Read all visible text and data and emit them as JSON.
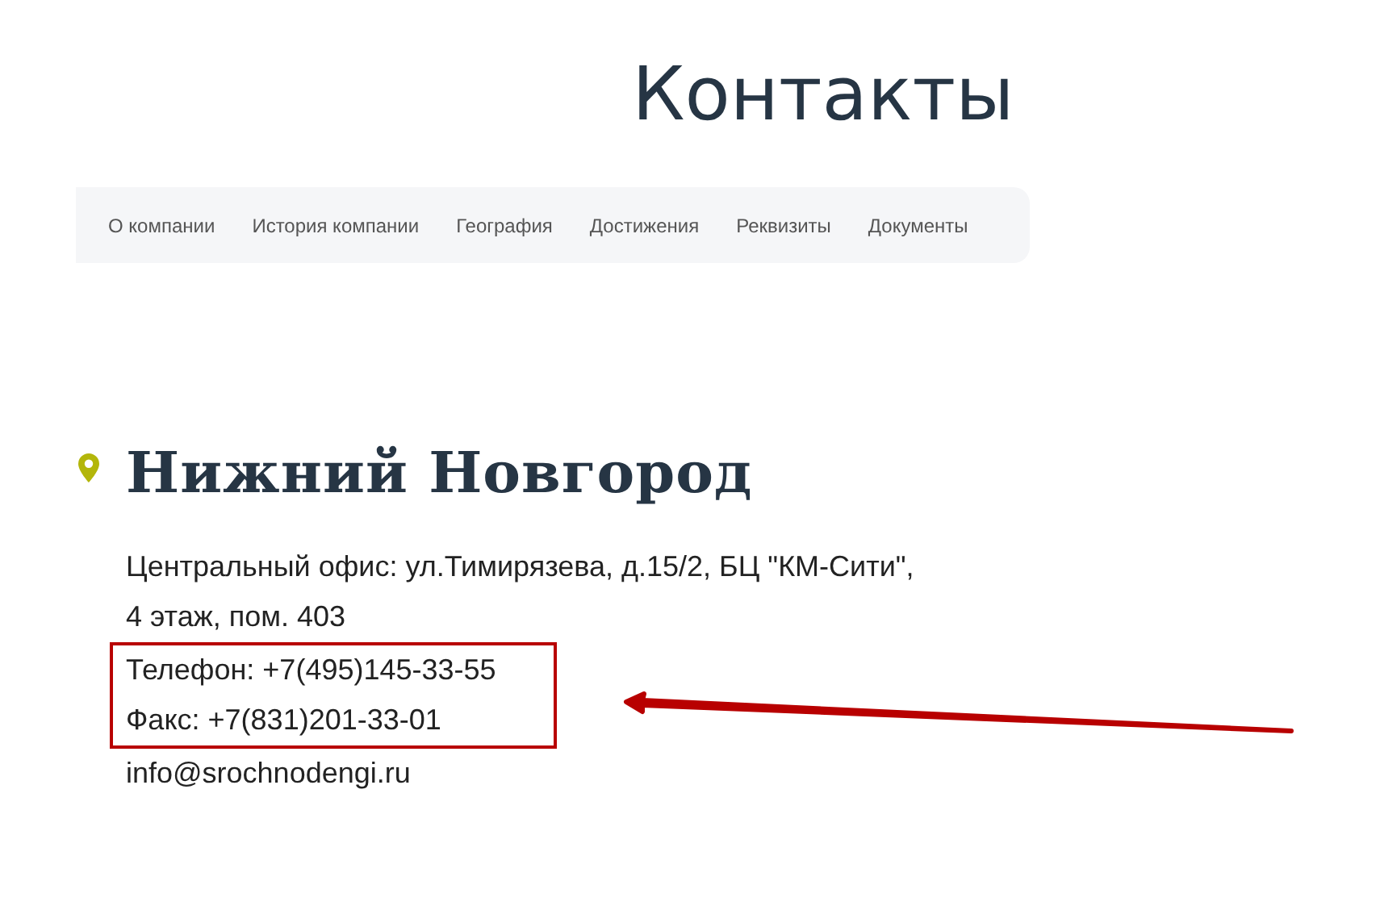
{
  "page_title": "Контакты",
  "nav": [
    {
      "label": "О компании"
    },
    {
      "label": "История компании"
    },
    {
      "label": "География"
    },
    {
      "label": "Достижения"
    },
    {
      "label": "Реквизиты"
    },
    {
      "label": "Документы"
    }
  ],
  "office": {
    "city": "Нижний Новгород",
    "address_lines": [
      "Центральный офис: ул.Тимирязева, д.15/2, БЦ \"КМ-Сити\",",
      "4 этаж, пом. 403"
    ],
    "phone": "Телефон: +7(495)145-33-55",
    "fax": "Факс: +7(831)201-33-01",
    "email": "info@srochnodengi.ru"
  }
}
